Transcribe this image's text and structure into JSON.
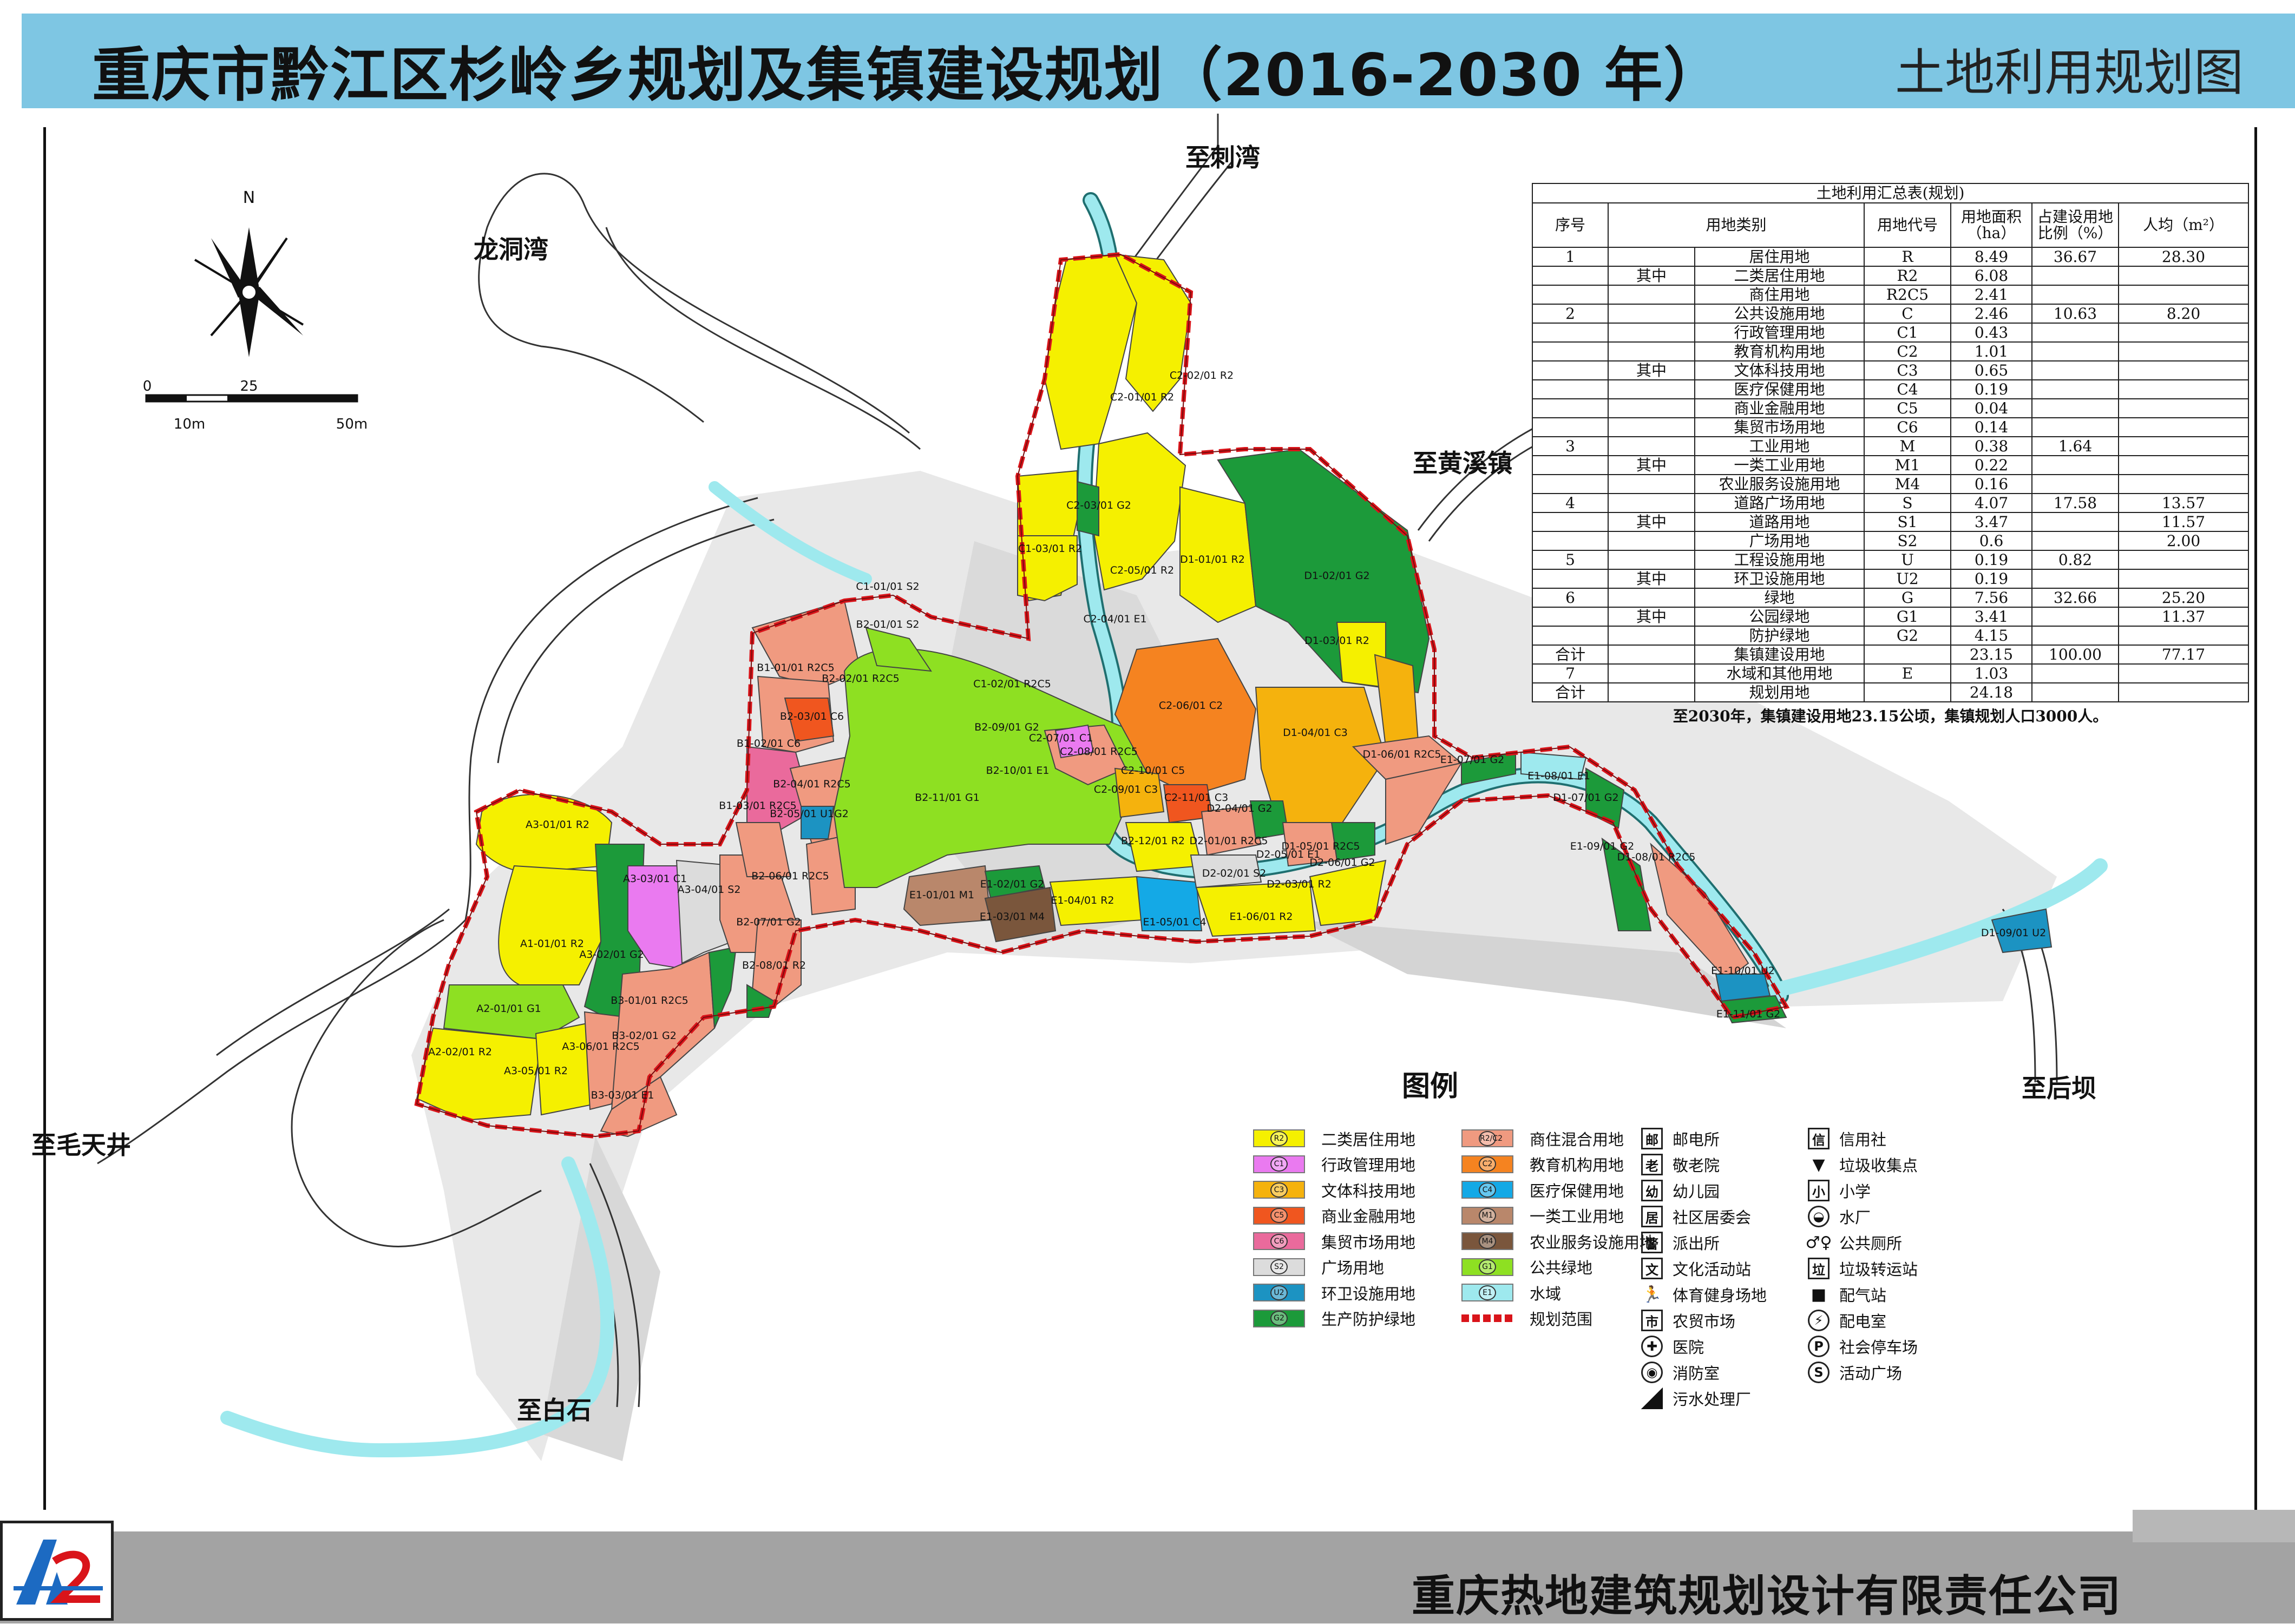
{
  "header": {
    "title": "重庆市黔江区杉岭乡规划及集镇建设规划（2016-2030 年）",
    "subtitle": "土地利用规划图"
  },
  "footer": {
    "company": "重庆热地建筑规划设计有限责任公司"
  },
  "compass": {
    "north": "N",
    "scale_ticks": [
      "0",
      "25",
      "10m",
      "50m"
    ]
  },
  "places": [
    "至刺湾",
    "龙洞湾",
    "至黄溪镇",
    "至后坝",
    "至毛天井",
    "至白石"
  ],
  "zones": [
    "A1-01/01 R2",
    "A2-01/01 G1",
    "A2-02/01 R2",
    "A3-01/01 R2",
    "A3-02/01 G2",
    "A3-03/01 C1",
    "A3-04/01 S2",
    "A3-05/01 R2",
    "A3-06/01 R2C5",
    "B1-01/01 R2C5",
    "B1-02/01 C6",
    "B1-03/01 R2C5",
    "B2-01/01 S2",
    "B2-02/01 R2C5",
    "B2-03/01 C6",
    "B2-04/01 R2C5",
    "B2-05/01 U1G2",
    "B2-06/01 R2C5",
    "B2-07/01 G2",
    "B2-08/01 R2",
    "B2-09/01 G2",
    "B2-10/01 E1",
    "B2-11/01 G1",
    "B2-12/01 R2",
    "B3-01/01 R2C5",
    "B3-02/01 G2",
    "B3-03/01 E1",
    "C1-01/01 S2",
    "C1-02/01 R2C5",
    "C1-03/01 R2",
    "C2-01/01 R2",
    "C2-02/01 R2",
    "C2-03/01 G2",
    "C2-04/01 E1",
    "C2-05/01 R2",
    "C2-06/01 C2",
    "C2-07/01 C1",
    "C2-08/01 R2C5",
    "C2-09/01 C3",
    "C2-10/01 C5",
    "C2-11/01 C3",
    "D1-01/01 R2",
    "D1-02/01 G2",
    "D1-03/01 R2",
    "D1-04/01 C3",
    "D1-05/01 R2C5",
    "D1-06/01 R2C5",
    "D1-07/01 G2",
    "D1-08/01 R2C5",
    "D1-09/01 U2",
    "D2-01/01 R2C5",
    "D2-02/01 S2",
    "D2-03/01 R2",
    "D2-04/01 G2",
    "D2-05/01 E1",
    "D2-06/01 G2",
    "E1-01/01 M1",
    "E1-02/01 G2",
    "E1-03/01 M4",
    "E1-04/01 R2",
    "E1-05/01 C4",
    "E1-06/01 R2",
    "E1-07/01 G2",
    "E1-08/01 E1",
    "E1-09/01 G2",
    "E1-10/01 U2",
    "E1-11/01 G2"
  ],
  "land_use_table": {
    "caption": "土地利用汇总表(规划)",
    "headers": [
      "序号",
      "用地类别",
      "用地代号",
      "用地面积（ha）",
      "占建设用地比例（%）",
      "人均（m²）"
    ],
    "rows": [
      {
        "no": "1",
        "group": "",
        "name": "居住用地",
        "code": "R",
        "area": "8.49",
        "ratio": "36.67",
        "per": "28.30"
      },
      {
        "no": "",
        "group": "其中",
        "name": "二类居住用地",
        "code": "R2",
        "area": "6.08",
        "ratio": "",
        "per": ""
      },
      {
        "no": "",
        "group": "",
        "name": "商住用地",
        "code": "R2C5",
        "area": "2.41",
        "ratio": "",
        "per": ""
      },
      {
        "no": "2",
        "group": "",
        "name": "公共设施用地",
        "code": "C",
        "area": "2.46",
        "ratio": "10.63",
        "per": "8.20"
      },
      {
        "no": "",
        "group": "",
        "name": "行政管理用地",
        "code": "C1",
        "area": "0.43",
        "ratio": "",
        "per": ""
      },
      {
        "no": "",
        "group": "",
        "name": "教育机构用地",
        "code": "C2",
        "area": "1.01",
        "ratio": "",
        "per": ""
      },
      {
        "no": "",
        "group": "其中",
        "name": "文体科技用地",
        "code": "C3",
        "area": "0.65",
        "ratio": "",
        "per": ""
      },
      {
        "no": "",
        "group": "",
        "name": "医疗保健用地",
        "code": "C4",
        "area": "0.19",
        "ratio": "",
        "per": ""
      },
      {
        "no": "",
        "group": "",
        "name": "商业金融用地",
        "code": "C5",
        "area": "0.04",
        "ratio": "",
        "per": ""
      },
      {
        "no": "",
        "group": "",
        "name": "集贸市场用地",
        "code": "C6",
        "area": "0.14",
        "ratio": "",
        "per": ""
      },
      {
        "no": "3",
        "group": "",
        "name": "工业用地",
        "code": "M",
        "area": "0.38",
        "ratio": "1.64",
        "per": ""
      },
      {
        "no": "",
        "group": "其中",
        "name": "一类工业用地",
        "code": "M1",
        "area": "0.22",
        "ratio": "",
        "per": ""
      },
      {
        "no": "",
        "group": "",
        "name": "农业服务设施用地",
        "code": "M4",
        "area": "0.16",
        "ratio": "",
        "per": ""
      },
      {
        "no": "4",
        "group": "",
        "name": "道路广场用地",
        "code": "S",
        "area": "4.07",
        "ratio": "17.58",
        "per": "13.57"
      },
      {
        "no": "",
        "group": "其中",
        "name": "道路用地",
        "code": "S1",
        "area": "3.47",
        "ratio": "",
        "per": "11.57"
      },
      {
        "no": "",
        "group": "",
        "name": "广场用地",
        "code": "S2",
        "area": "0.6",
        "ratio": "",
        "per": "2.00"
      },
      {
        "no": "5",
        "group": "",
        "name": "工程设施用地",
        "code": "U",
        "area": "0.19",
        "ratio": "0.82",
        "per": ""
      },
      {
        "no": "",
        "group": "其中",
        "name": "环卫设施用地",
        "code": "U2",
        "area": "0.19",
        "ratio": "",
        "per": ""
      },
      {
        "no": "6",
        "group": "",
        "name": "绿地",
        "code": "G",
        "area": "7.56",
        "ratio": "32.66",
        "per": "25.20"
      },
      {
        "no": "",
        "group": "其中",
        "name": "公园绿地",
        "code": "G1",
        "area": "3.41",
        "ratio": "",
        "per": "11.37"
      },
      {
        "no": "",
        "group": "",
        "name": "防护绿地",
        "code": "G2",
        "area": "4.15",
        "ratio": "",
        "per": ""
      },
      {
        "no": "合计",
        "group": "",
        "name": "集镇建设用地",
        "code": "",
        "area": "23.15",
        "ratio": "100.00",
        "per": "77.17"
      },
      {
        "no": "7",
        "group": "",
        "name": "水域和其他用地",
        "code": "E",
        "area": "1.03",
        "ratio": "",
        "per": ""
      },
      {
        "no": "合计",
        "group": "",
        "name": "规划用地",
        "code": "",
        "area": "24.18",
        "ratio": "",
        "per": ""
      }
    ],
    "note": "至2030年，集镇建设用地23.15公顷，集镇规划人口3000人。"
  },
  "legend": {
    "title": "图例",
    "colors": [
      {
        "code": "R2",
        "label": "二类居住用地",
        "color": "#f5f000"
      },
      {
        "code": "C1",
        "label": "行政管理用地",
        "color": "#ea7af0"
      },
      {
        "code": "C3",
        "label": "文体科技用地",
        "color": "#f5b20d"
      },
      {
        "code": "C5",
        "label": "商业金融用地",
        "color": "#f0561f"
      },
      {
        "code": "C6",
        "label": "集贸市场用地",
        "color": "#ea6a9c"
      },
      {
        "code": "S2",
        "label": "广场用地",
        "color": "#dcdcdc"
      },
      {
        "code": "U2",
        "label": "环卫设施用地",
        "color": "#1c93c2"
      },
      {
        "code": "G2",
        "label": "生产防护绿地",
        "color": "#1c9a3a"
      },
      {
        "code": "R2/C2",
        "label": "商住混合用地",
        "color": "#f09a80"
      },
      {
        "code": "C2",
        "label": "教育机构用地",
        "color": "#f58320"
      },
      {
        "code": "C4",
        "label": "医疗保健用地",
        "color": "#14a9e6"
      },
      {
        "code": "M1",
        "label": "一类工业用地",
        "color": "#b9876b"
      },
      {
        "code": "M4",
        "label": "农业服务设施用地",
        "color": "#7a563c"
      },
      {
        "code": "G1",
        "label": "公共绿地",
        "color": "#8ee022"
      },
      {
        "code": "E1",
        "label": "水域",
        "color": "#9ee9ee"
      },
      {
        "code": "",
        "label": "规划范围",
        "color": "#d9141a"
      }
    ],
    "symbols_a": [
      {
        "glyph": "邮",
        "label": "邮电所"
      },
      {
        "glyph": "老",
        "label": "敬老院"
      },
      {
        "glyph": "幼",
        "label": "幼儿园"
      },
      {
        "glyph": "居",
        "label": "社区居委会"
      },
      {
        "glyph": "警",
        "label": "派出所"
      },
      {
        "glyph": "文",
        "label": "文化活动站"
      },
      {
        "glyph": "🏃",
        "label": "体育健身场地"
      },
      {
        "glyph": "市",
        "label": "农贸市场"
      },
      {
        "glyph": "✚",
        "label": "医院"
      },
      {
        "glyph": "◉",
        "label": "消防室"
      },
      {
        "glyph": "◢",
        "label": "污水处理厂"
      }
    ],
    "symbols_b": [
      {
        "glyph": "信",
        "label": "信用社"
      },
      {
        "glyph": "▼",
        "label": "垃圾收集点"
      },
      {
        "glyph": "小",
        "label": "小学"
      },
      {
        "glyph": "◒",
        "label": "水厂"
      },
      {
        "glyph": "♂♀",
        "label": "公共厕所"
      },
      {
        "glyph": "垃",
        "label": "垃圾转运站"
      },
      {
        "glyph": "■",
        "label": "配气站"
      },
      {
        "glyph": "⚡",
        "label": "配电室"
      },
      {
        "glyph": "P",
        "label": "社会停车场"
      },
      {
        "glyph": "S",
        "label": "活动广场"
      }
    ]
  }
}
